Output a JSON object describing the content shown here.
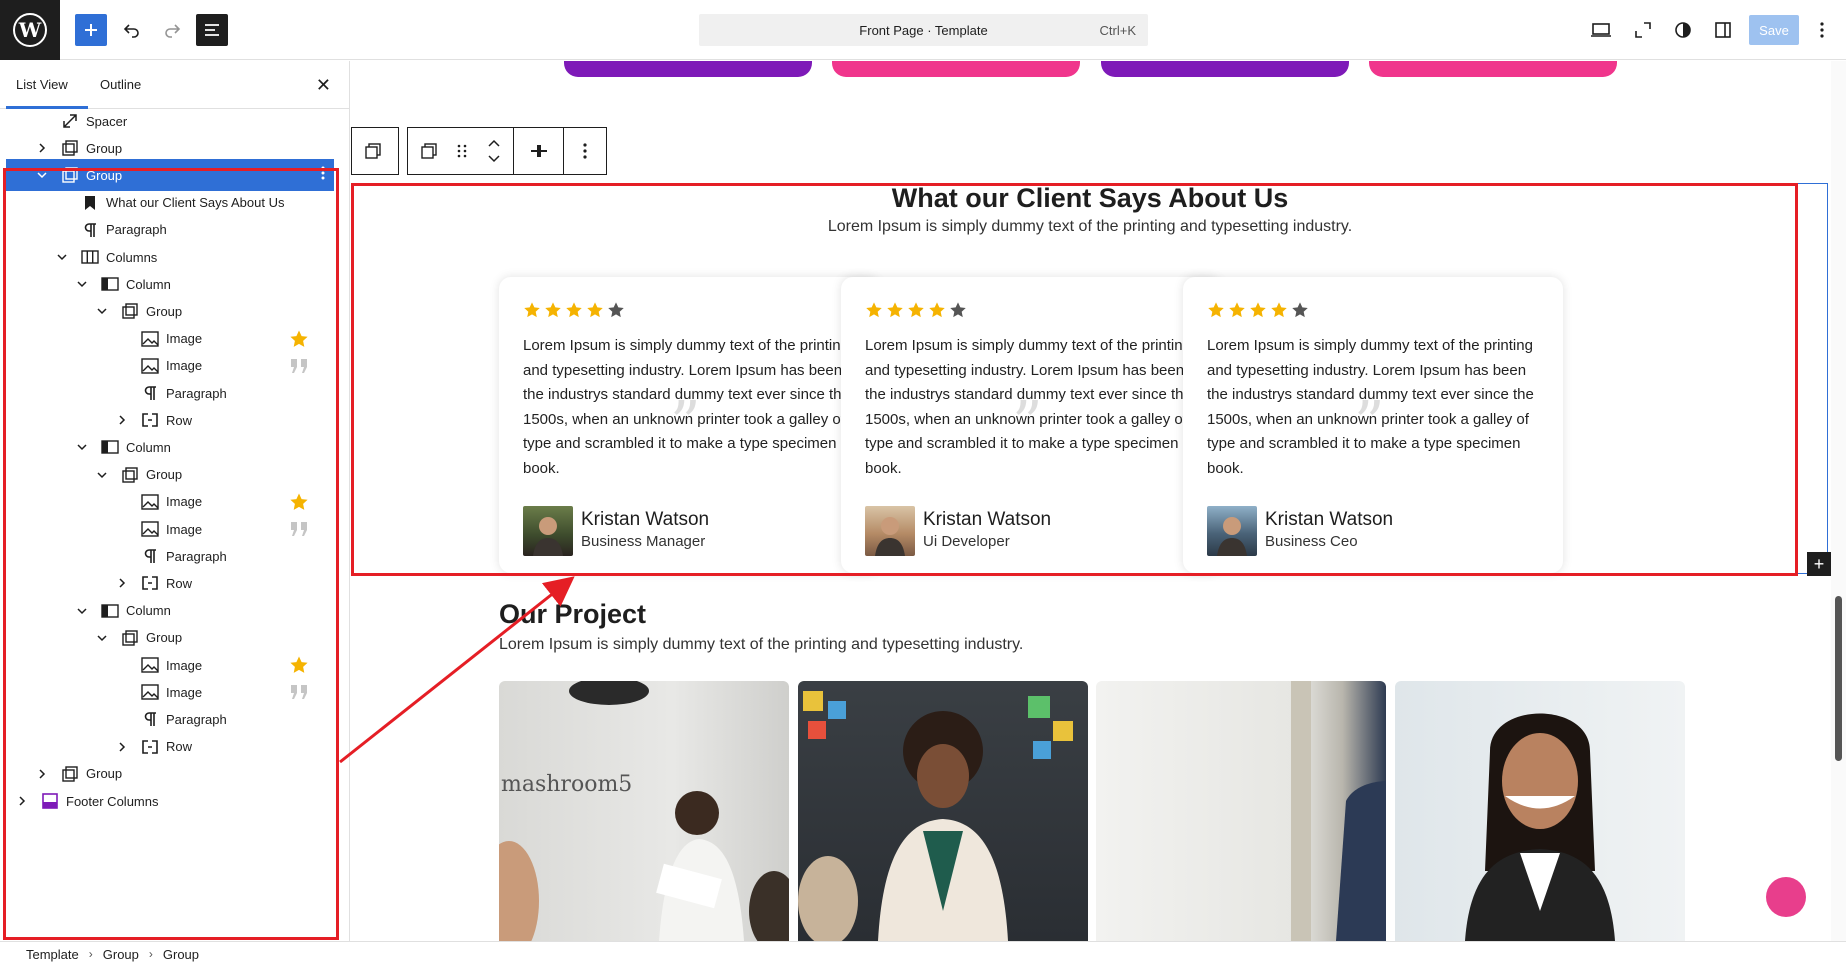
{
  "topbar": {
    "template_title": "Front Page · Template",
    "shortcut": "Ctrl+K",
    "save_label": "Save"
  },
  "sidebar": {
    "tabs": [
      "List View",
      "Outline"
    ],
    "tree": [
      {
        "label": "Spacer",
        "icon": "spacer-icon"
      },
      {
        "label": "Group",
        "icon": "group-icon"
      },
      {
        "label": "Group",
        "icon": "group-icon",
        "selected": true
      },
      {
        "label": "What our Client Says About Us",
        "icon": "heading-icon"
      },
      {
        "label": "Paragraph",
        "icon": "paragraph-icon"
      },
      {
        "label": "Columns",
        "icon": "columns-icon"
      },
      {
        "label": "Column",
        "icon": "column-icon"
      },
      {
        "label": "Group",
        "icon": "group-icon"
      },
      {
        "label": "Image",
        "icon": "image-icon",
        "badge": "star"
      },
      {
        "label": "Image",
        "icon": "image-icon",
        "badge": "quote"
      },
      {
        "label": "Paragraph",
        "icon": "paragraph-icon"
      },
      {
        "label": "Row",
        "icon": "row-icon"
      },
      {
        "label": "Column",
        "icon": "column-icon"
      },
      {
        "label": "Group",
        "icon": "group-icon"
      },
      {
        "label": "Image",
        "icon": "image-icon",
        "badge": "star"
      },
      {
        "label": "Image",
        "icon": "image-icon",
        "badge": "quote"
      },
      {
        "label": "Paragraph",
        "icon": "paragraph-icon"
      },
      {
        "label": "Row",
        "icon": "row-icon"
      },
      {
        "label": "Column",
        "icon": "column-icon"
      },
      {
        "label": "Group",
        "icon": "group-icon"
      },
      {
        "label": "Image",
        "icon": "image-icon",
        "badge": "star"
      },
      {
        "label": "Image",
        "icon": "image-icon",
        "badge": "quote"
      },
      {
        "label": "Paragraph",
        "icon": "paragraph-icon"
      },
      {
        "label": "Row",
        "icon": "row-icon"
      },
      {
        "label": "Group",
        "icon": "group-icon"
      },
      {
        "label": "Footer Columns",
        "icon": "template-part-icon"
      }
    ]
  },
  "breadcrumb": [
    "Template",
    "Group",
    "Group"
  ],
  "testimonials": {
    "title": "What our Client Says About Us",
    "subtitle": "Lorem Ipsum is simply dummy text of the printing and typesetting industry.",
    "cards": [
      {
        "rating": 4,
        "text": "Lorem Ipsum is simply dummy text of the printing and typesetting industry. Lorem Ipsum has been the industrys standard dummy text ever since the 1500s, when an unknown printer took a galley of type and scrambled it to make a type specimen book.",
        "name": "Kristan Watson",
        "role": "Business Manager"
      },
      {
        "rating": 4,
        "text": "Lorem Ipsum is simply dummy text of the printing and typesetting industry. Lorem Ipsum has been the industrys standard dummy text ever since the 1500s, when an unknown printer took a galley of type and scrambled it to make a type specimen book.",
        "name": "Kristan Watson",
        "role": "Ui Developer"
      },
      {
        "rating": 4,
        "text": "Lorem Ipsum is simply dummy text of the printing and typesetting industry. Lorem Ipsum has been the industrys standard dummy text ever since the 1500s, when an unknown printer took a galley of type and scrambled it to make a type specimen book.",
        "name": "Kristan Watson",
        "role": "Business Ceo"
      }
    ]
  },
  "project": {
    "title": "Our Project",
    "subtitle": "Lorem Ipsum is simply dummy text of the printing and typesetting industry."
  },
  "colors": {
    "accent": "#2f6fd6",
    "annotation_red": "#e51e25",
    "star_gold": "#f5b301",
    "star_empty": "#555555",
    "pill_purple": "#7e1ab8",
    "pill_pink": "#f0358c",
    "fab_pink": "#e83e8c"
  }
}
